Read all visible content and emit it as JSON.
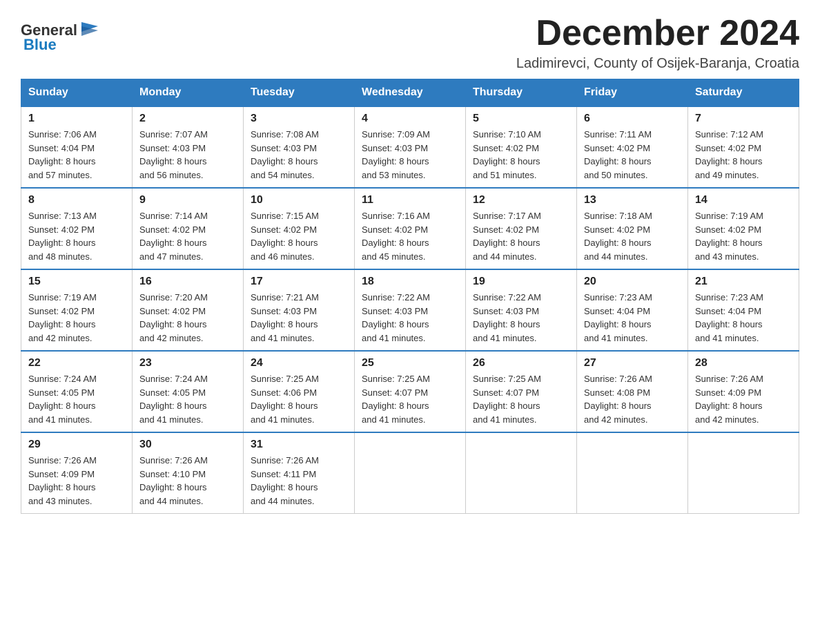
{
  "header": {
    "logo_general": "General",
    "logo_blue": "Blue",
    "month_title": "December 2024",
    "subtitle": "Ladimirevci, County of Osijek-Baranja, Croatia"
  },
  "columns": [
    "Sunday",
    "Monday",
    "Tuesday",
    "Wednesday",
    "Thursday",
    "Friday",
    "Saturday"
  ],
  "weeks": [
    [
      {
        "day": "1",
        "sunrise": "7:06 AM",
        "sunset": "4:04 PM",
        "daylight": "8 hours and 57 minutes."
      },
      {
        "day": "2",
        "sunrise": "7:07 AM",
        "sunset": "4:03 PM",
        "daylight": "8 hours and 56 minutes."
      },
      {
        "day": "3",
        "sunrise": "7:08 AM",
        "sunset": "4:03 PM",
        "daylight": "8 hours and 54 minutes."
      },
      {
        "day": "4",
        "sunrise": "7:09 AM",
        "sunset": "4:03 PM",
        "daylight": "8 hours and 53 minutes."
      },
      {
        "day": "5",
        "sunrise": "7:10 AM",
        "sunset": "4:02 PM",
        "daylight": "8 hours and 51 minutes."
      },
      {
        "day": "6",
        "sunrise": "7:11 AM",
        "sunset": "4:02 PM",
        "daylight": "8 hours and 50 minutes."
      },
      {
        "day": "7",
        "sunrise": "7:12 AM",
        "sunset": "4:02 PM",
        "daylight": "8 hours and 49 minutes."
      }
    ],
    [
      {
        "day": "8",
        "sunrise": "7:13 AM",
        "sunset": "4:02 PM",
        "daylight": "8 hours and 48 minutes."
      },
      {
        "day": "9",
        "sunrise": "7:14 AM",
        "sunset": "4:02 PM",
        "daylight": "8 hours and 47 minutes."
      },
      {
        "day": "10",
        "sunrise": "7:15 AM",
        "sunset": "4:02 PM",
        "daylight": "8 hours and 46 minutes."
      },
      {
        "day": "11",
        "sunrise": "7:16 AM",
        "sunset": "4:02 PM",
        "daylight": "8 hours and 45 minutes."
      },
      {
        "day": "12",
        "sunrise": "7:17 AM",
        "sunset": "4:02 PM",
        "daylight": "8 hours and 44 minutes."
      },
      {
        "day": "13",
        "sunrise": "7:18 AM",
        "sunset": "4:02 PM",
        "daylight": "8 hours and 44 minutes."
      },
      {
        "day": "14",
        "sunrise": "7:19 AM",
        "sunset": "4:02 PM",
        "daylight": "8 hours and 43 minutes."
      }
    ],
    [
      {
        "day": "15",
        "sunrise": "7:19 AM",
        "sunset": "4:02 PM",
        "daylight": "8 hours and 42 minutes."
      },
      {
        "day": "16",
        "sunrise": "7:20 AM",
        "sunset": "4:02 PM",
        "daylight": "8 hours and 42 minutes."
      },
      {
        "day": "17",
        "sunrise": "7:21 AM",
        "sunset": "4:03 PM",
        "daylight": "8 hours and 41 minutes."
      },
      {
        "day": "18",
        "sunrise": "7:22 AM",
        "sunset": "4:03 PM",
        "daylight": "8 hours and 41 minutes."
      },
      {
        "day": "19",
        "sunrise": "7:22 AM",
        "sunset": "4:03 PM",
        "daylight": "8 hours and 41 minutes."
      },
      {
        "day": "20",
        "sunrise": "7:23 AM",
        "sunset": "4:04 PM",
        "daylight": "8 hours and 41 minutes."
      },
      {
        "day": "21",
        "sunrise": "7:23 AM",
        "sunset": "4:04 PM",
        "daylight": "8 hours and 41 minutes."
      }
    ],
    [
      {
        "day": "22",
        "sunrise": "7:24 AM",
        "sunset": "4:05 PM",
        "daylight": "8 hours and 41 minutes."
      },
      {
        "day": "23",
        "sunrise": "7:24 AM",
        "sunset": "4:05 PM",
        "daylight": "8 hours and 41 minutes."
      },
      {
        "day": "24",
        "sunrise": "7:25 AM",
        "sunset": "4:06 PM",
        "daylight": "8 hours and 41 minutes."
      },
      {
        "day": "25",
        "sunrise": "7:25 AM",
        "sunset": "4:07 PM",
        "daylight": "8 hours and 41 minutes."
      },
      {
        "day": "26",
        "sunrise": "7:25 AM",
        "sunset": "4:07 PM",
        "daylight": "8 hours and 41 minutes."
      },
      {
        "day": "27",
        "sunrise": "7:26 AM",
        "sunset": "4:08 PM",
        "daylight": "8 hours and 42 minutes."
      },
      {
        "day": "28",
        "sunrise": "7:26 AM",
        "sunset": "4:09 PM",
        "daylight": "8 hours and 42 minutes."
      }
    ],
    [
      {
        "day": "29",
        "sunrise": "7:26 AM",
        "sunset": "4:09 PM",
        "daylight": "8 hours and 43 minutes."
      },
      {
        "day": "30",
        "sunrise": "7:26 AM",
        "sunset": "4:10 PM",
        "daylight": "8 hours and 44 minutes."
      },
      {
        "day": "31",
        "sunrise": "7:26 AM",
        "sunset": "4:11 PM",
        "daylight": "8 hours and 44 minutes."
      },
      null,
      null,
      null,
      null
    ]
  ],
  "labels": {
    "sunrise": "Sunrise:",
    "sunset": "Sunset:",
    "daylight": "Daylight:"
  }
}
